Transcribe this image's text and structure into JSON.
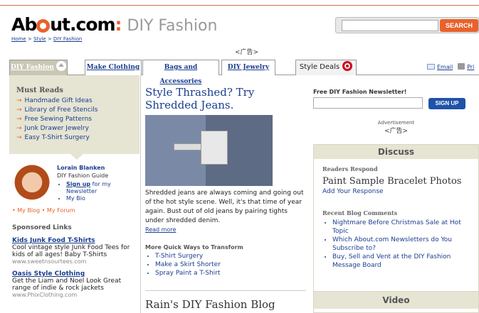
{
  "header": {
    "logo_brand": "About.com",
    "logo_brand_pre": "Ab",
    "logo_brand_post": "ut.com",
    "logo_colon": ":",
    "logo_site": " DIY Fashion",
    "breadcrumb": [
      "Home",
      "Style",
      "DIY Fashion"
    ],
    "breadcrumb_sep": " > ",
    "search_button": "SEARCH",
    "search_value": ""
  },
  "top_ad": "<广告>",
  "nav": {
    "tabs": [
      {
        "label": "DIY Fashion",
        "active": true
      },
      {
        "label": "Make Clothing",
        "active": false
      },
      {
        "label": "Bags and Accessories",
        "active": false
      },
      {
        "label": "DIY Jewelry",
        "active": false
      },
      {
        "label": "Style Deals",
        "active": false
      }
    ],
    "email_label": "Email",
    "print_label": "Pri"
  },
  "must_reads": {
    "heading": "Must Reads",
    "items": [
      "Handmade Gift Ideas",
      "Library of Free Stencils",
      "Free Sewing Patterns",
      "Junk Drawer Jewelry",
      "Easy T-Shirt Surgery"
    ]
  },
  "guide": {
    "name": "Lorain Blanken",
    "role": "DIY Fashion Guide",
    "signup_bold": "Sign up",
    "signup_rest": " for my Newsletter",
    "bio": "My Bio"
  },
  "my_links": "• My Blog • My Forum",
  "sponsored": {
    "heading": "Sponsored Links",
    "items": [
      {
        "title": "Kids Junk Food T-Shirts",
        "desc": "Cool vintage style Junk Food Tees for kids of all ages! Baby T-Shirts",
        "url": "www.sweetnsourtees.com"
      },
      {
        "title": "Oasis Style Clothing",
        "desc": "Get the Liam and Noel Look Great range of indie & rock jackets",
        "url": "www.PhixClothing.com"
      }
    ]
  },
  "article": {
    "headline": "Style Thrashed? Try Shredded Jeans.",
    "body": "Shredded jeans are always coming and going out of the hot style scene. Well, it's that time of year again. Bust out of old jeans by pairing tights under shredded denim.",
    "read_more": "Read more",
    "more_heading": "More Quick Ways to Transform",
    "more_items": [
      "T-Shirt Surgery",
      "Make a Skirt Shorter",
      "Spray Paint a T-Shirt"
    ]
  },
  "blog_title": "Rain's DIY Fashion Blog",
  "newsletter": {
    "label": "Free DIY Fashion Newsletter!",
    "button": "SIGN UP",
    "value": ""
  },
  "advertisement": {
    "label": "Advertisement",
    "ad": "<广告>"
  },
  "discuss": {
    "heading": "Discuss",
    "readers_respond": "Readers Respond",
    "topic": "Paint Sample Bracelet Photos",
    "add_response": "Add Your Response",
    "recent_heading": "Recent Blog Comments",
    "comments": [
      "Nightmare Before Christmas Sale at Hot Topic",
      "Which About.com Newsletters do You Subscribe to?",
      "Buy, Sell and Vent at the DIY Fashion Message Board"
    ]
  },
  "video": {
    "heading": "Video"
  },
  "colors": {
    "accent": "#e8622c",
    "link": "#1a3d8f",
    "tab_active": "#c9c7b3",
    "panel": "#e6e4d2"
  }
}
